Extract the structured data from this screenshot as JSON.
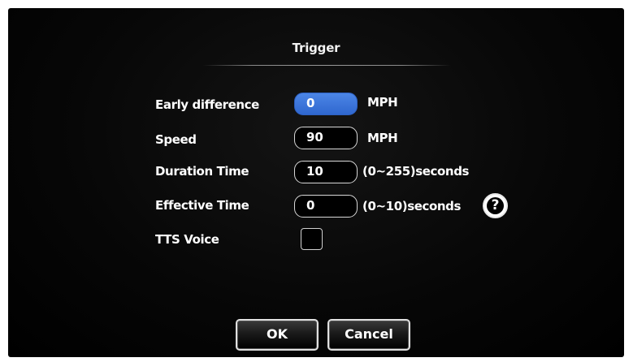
{
  "dialog": {
    "title": "Trigger"
  },
  "fields": {
    "early_difference": {
      "label": "Early difference",
      "value": "0",
      "unit": "MPH",
      "selected": true
    },
    "speed": {
      "label": "Speed",
      "value": "90",
      "unit": "MPH"
    },
    "duration_time": {
      "label": "Duration Time",
      "value": "10",
      "unit": "(0~255)seconds"
    },
    "effective_time": {
      "label": "Effective Time",
      "value": "0",
      "unit": "(0~10)seconds"
    },
    "tts_voice": {
      "label": "TTS Voice",
      "checked": false
    }
  },
  "help": {
    "symbol": "?",
    "icon": "help-icon"
  },
  "buttons": {
    "ok": "OK",
    "cancel": "Cancel"
  },
  "colors": {
    "background": "#000000",
    "selected_field": "#3a72d8",
    "text": "#ffffff"
  }
}
